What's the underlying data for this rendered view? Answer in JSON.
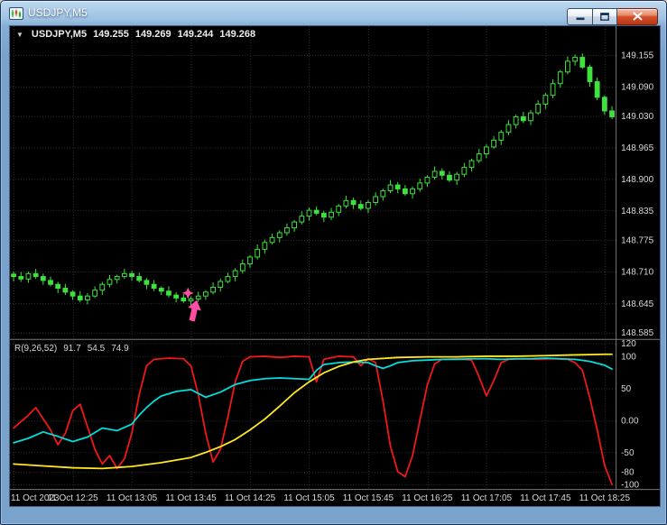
{
  "window": {
    "title": "USDJPY,M5",
    "controls": {
      "minimize": "minimize-icon",
      "maximize": "maximize-icon",
      "close": "close-icon"
    }
  },
  "quote_header": {
    "dropdown_arrow": "▼",
    "symbol": "USDJPY,M5",
    "open": "149.255",
    "high": "149.269",
    "low": "149.244",
    "close": "149.268"
  },
  "indicator_header": {
    "name": "R(9,26,52)",
    "values": [
      "91.7",
      "54.5",
      "74.9"
    ]
  },
  "chart_data": {
    "type": "candlestick",
    "symbol": "USDJPY",
    "timeframe": "M5",
    "grid": true,
    "colors": {
      "background": "#000000",
      "grid": "#333333",
      "candle_outline": "#3ee23e",
      "bull": "#000000",
      "bear": "#3ee23e",
      "axis_text": "#d8d8d8",
      "separator": "#787878",
      "signal": "#ff4fa3"
    },
    "price_axis": {
      "ticks": [
        "149.155",
        "149.090",
        "149.030",
        "148.965",
        "148.900",
        "148.835",
        "148.775",
        "148.710",
        "148.645",
        "148.585"
      ],
      "range": [
        148.572,
        149.214
      ]
    },
    "time_axis": {
      "labels": [
        {
          "index": 0,
          "text": "11 Oct 2023"
        },
        {
          "index": 8,
          "text": "11 Oct 12:25"
        },
        {
          "index": 16,
          "text": "11 Oct 13:05"
        },
        {
          "index": 24,
          "text": "11 Oct 13:45"
        },
        {
          "index": 32,
          "text": "11 Oct 14:25"
        },
        {
          "index": 40,
          "text": "11 Oct 15:05"
        },
        {
          "index": 48,
          "text": "11 Oct 15:45"
        },
        {
          "index": 56,
          "text": "11 Oct 16:25"
        },
        {
          "index": 64,
          "text": "11 Oct 17:05"
        },
        {
          "index": 72,
          "text": "11 Oct 17:45"
        },
        {
          "index": 80,
          "text": "11 Oct 18:25"
        }
      ]
    },
    "candles": {
      "first_open": 148.705,
      "wick_pattern": [
        0.005,
        0.009,
        0.004,
        0.01,
        0.006,
        0.008
      ],
      "closes": [
        148.7,
        148.695,
        148.706,
        148.7,
        148.692,
        148.684,
        148.676,
        148.668,
        148.66,
        148.652,
        148.66,
        148.672,
        148.684,
        148.694,
        148.7,
        148.706,
        148.7,
        148.692,
        148.684,
        148.676,
        148.67,
        148.662,
        148.656,
        148.65,
        148.654,
        148.66,
        148.668,
        148.678,
        148.69,
        148.7,
        148.712,
        148.726,
        148.74,
        148.756,
        148.77,
        148.78,
        148.79,
        148.8,
        148.812,
        148.824,
        148.836,
        148.83,
        148.822,
        148.832,
        148.845,
        148.856,
        148.848,
        148.84,
        148.852,
        148.864,
        148.876,
        148.888,
        148.88,
        148.87,
        148.88,
        148.892,
        148.904,
        148.916,
        148.908,
        148.898,
        148.91,
        148.924,
        148.938,
        148.952,
        148.966,
        148.98,
        148.996,
        149.012,
        149.028,
        149.02,
        149.036,
        149.054,
        149.072,
        149.096,
        149.12,
        149.142,
        149.15,
        149.13,
        149.1,
        149.068,
        149.04,
        149.028
      ]
    },
    "objects": [
      {
        "type": "star",
        "index": 23.6,
        "price": 148.666,
        "color": "#ff4fa3"
      },
      {
        "type": "arrow_up",
        "index": 24.8,
        "price": 148.652,
        "color": "#ff4fa3"
      }
    ],
    "oscillator": {
      "label": "R(9,26,52) 91.7 54.5 74.9",
      "axis_ticks": [
        "120",
        "100",
        "50",
        "0.00",
        "-50",
        "-80",
        "-100"
      ],
      "range": [
        -107,
        125.6
      ],
      "series": [
        {
          "name": "red",
          "color": "#f01818",
          "points": [
            [
              0,
              -12
            ],
            [
              2,
              8
            ],
            [
              3,
              20
            ],
            [
              5,
              -15
            ],
            [
              6,
              -38
            ],
            [
              7,
              -20
            ],
            [
              8,
              15
            ],
            [
              9,
              25
            ],
            [
              10,
              -10
            ],
            [
              11,
              -45
            ],
            [
              12,
              -68
            ],
            [
              13,
              -55
            ],
            [
              14,
              -75
            ],
            [
              15,
              -60
            ],
            [
              16,
              -20
            ],
            [
              17,
              40
            ],
            [
              18,
              85
            ],
            [
              19,
              95
            ],
            [
              21,
              97
            ],
            [
              23,
              96
            ],
            [
              24,
              85
            ],
            [
              25,
              40
            ],
            [
              26,
              -20
            ],
            [
              27,
              -65
            ],
            [
              28,
              -45
            ],
            [
              29,
              5
            ],
            [
              30,
              60
            ],
            [
              31,
              92
            ],
            [
              32,
              99
            ],
            [
              34,
              100
            ],
            [
              36,
              98
            ],
            [
              38,
              100
            ],
            [
              40,
              99
            ],
            [
              41,
              60
            ],
            [
              42,
              95
            ],
            [
              44,
              100
            ],
            [
              46,
              99
            ],
            [
              47,
              85
            ],
            [
              48,
              96
            ],
            [
              49,
              90
            ],
            [
              50,
              30
            ],
            [
              51,
              -40
            ],
            [
              52,
              -80
            ],
            [
              53,
              -88
            ],
            [
              54,
              -55
            ],
            [
              55,
              0
            ],
            [
              56,
              55
            ],
            [
              57,
              88
            ],
            [
              58,
              95
            ],
            [
              60,
              96
            ],
            [
              62,
              94
            ],
            [
              63,
              68
            ],
            [
              64,
              38
            ],
            [
              65,
              62
            ],
            [
              66,
              90
            ],
            [
              67,
              95
            ],
            [
              69,
              96
            ],
            [
              71,
              95
            ],
            [
              73,
              96
            ],
            [
              75,
              95
            ],
            [
              76,
              90
            ],
            [
              77,
              78
            ],
            [
              78,
              35
            ],
            [
              79,
              -15
            ],
            [
              80,
              -70
            ],
            [
              81,
              -100
            ]
          ]
        },
        {
          "name": "aqua",
          "color": "#00dede",
          "points": [
            [
              0,
              -35
            ],
            [
              2,
              -28
            ],
            [
              4,
              -18
            ],
            [
              6,
              -25
            ],
            [
              8,
              -33
            ],
            [
              10,
              -26
            ],
            [
              12,
              -12
            ],
            [
              14,
              -16
            ],
            [
              16,
              -6
            ],
            [
              17,
              8
            ],
            [
              18,
              20
            ],
            [
              19,
              30
            ],
            [
              20,
              38
            ],
            [
              22,
              45
            ],
            [
              24,
              48
            ],
            [
              25,
              42
            ],
            [
              26,
              36
            ],
            [
              28,
              44
            ],
            [
              30,
              56
            ],
            [
              32,
              62
            ],
            [
              34,
              65
            ],
            [
              36,
              66
            ],
            [
              38,
              65
            ],
            [
              40,
              64
            ],
            [
              41,
              78
            ],
            [
              42,
              87
            ],
            [
              44,
              90
            ],
            [
              46,
              91
            ],
            [
              48,
              90
            ],
            [
              49,
              85
            ],
            [
              50,
              81
            ],
            [
              51,
              85
            ],
            [
              52,
              90
            ],
            [
              54,
              93
            ],
            [
              56,
              94
            ],
            [
              58,
              95
            ],
            [
              60,
              95
            ],
            [
              62,
              96
            ],
            [
              64,
              96
            ],
            [
              66,
              95
            ],
            [
              68,
              96
            ],
            [
              70,
              96
            ],
            [
              72,
              97
            ],
            [
              74,
              96
            ],
            [
              76,
              95
            ],
            [
              78,
              92
            ],
            [
              80,
              86
            ],
            [
              81,
              80
            ]
          ]
        },
        {
          "name": "yellow",
          "color": "#ffe81e",
          "points": [
            [
              0,
              -68
            ],
            [
              4,
              -71
            ],
            [
              8,
              -74
            ],
            [
              12,
              -75
            ],
            [
              16,
              -72
            ],
            [
              20,
              -66
            ],
            [
              24,
              -58
            ],
            [
              26,
              -50
            ],
            [
              28,
              -41
            ],
            [
              30,
              -30
            ],
            [
              32,
              -15
            ],
            [
              34,
              2
            ],
            [
              36,
              22
            ],
            [
              38,
              43
            ],
            [
              40,
              60
            ],
            [
              42,
              74
            ],
            [
              44,
              84
            ],
            [
              46,
              91
            ],
            [
              48,
              95
            ],
            [
              52,
              98
            ],
            [
              56,
              99
            ],
            [
              60,
              99
            ],
            [
              64,
              100
            ],
            [
              68,
              100
            ],
            [
              72,
              101
            ],
            [
              76,
              102
            ],
            [
              80,
              103
            ],
            [
              81,
              103
            ]
          ]
        }
      ]
    }
  }
}
